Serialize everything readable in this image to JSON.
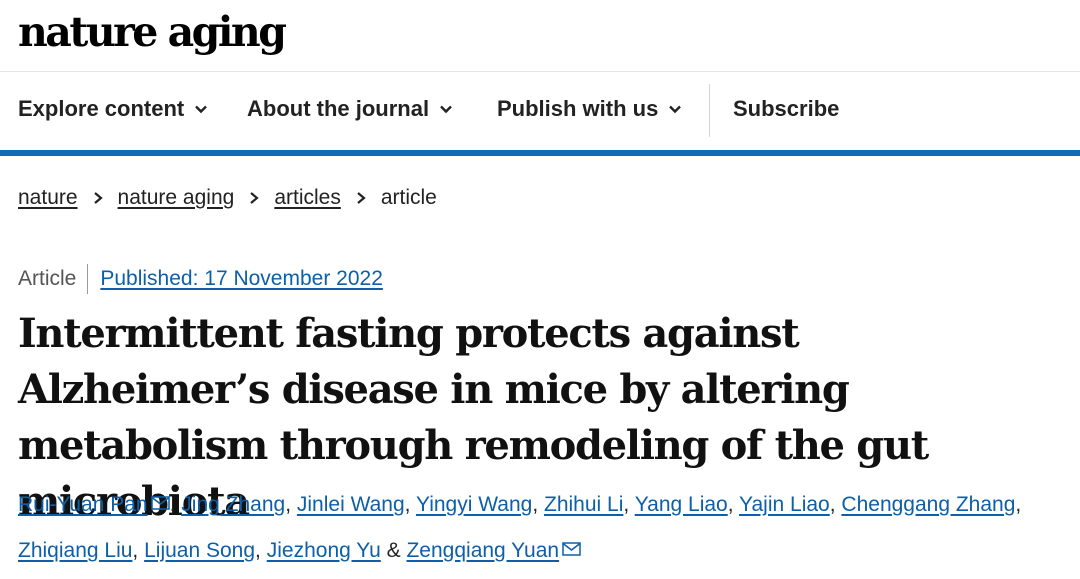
{
  "journal": {
    "logo_text": "nature aging"
  },
  "nav": {
    "items": [
      {
        "label": "Explore content",
        "icon": "chevron-down-icon"
      },
      {
        "label": "About the journal",
        "icon": "chevron-down-icon"
      },
      {
        "label": "Publish with us",
        "icon": "chevron-down-icon"
      }
    ],
    "subscribe_label": "Subscribe"
  },
  "colors": {
    "accent_rule": "#0f6bb5",
    "link": "#0c5fa8"
  },
  "breadcrumb": {
    "items": [
      "nature",
      "nature aging",
      "articles"
    ],
    "current": "article"
  },
  "article": {
    "type": "Article",
    "published": "Published: 17 November 2022",
    "title": "Intermittent fasting protects against Alzheimer’s disease in mice by altering metabolism through remodeling of the gut microbiota"
  },
  "authors": {
    "list": [
      {
        "name": "Rui-Yuan Pan",
        "corresponding": true
      },
      {
        "name": "Jing Zhang"
      },
      {
        "name": "Jinlei Wang"
      },
      {
        "name": "Yingyi Wang"
      },
      {
        "name": "Zhihui Li"
      },
      {
        "name": "Yang Liao"
      },
      {
        "name": "Yajin Liao"
      },
      {
        "name": "Chenggang Zhang"
      },
      {
        "name": "Zhiqiang Liu"
      },
      {
        "name": "Lijuan Song"
      },
      {
        "name": "Jiezhong Yu"
      },
      {
        "name": "Zengqiang Yuan",
        "corresponding": true
      }
    ],
    "separator": ",",
    "last_separator": "&",
    "mail_icon": "envelope-icon"
  }
}
